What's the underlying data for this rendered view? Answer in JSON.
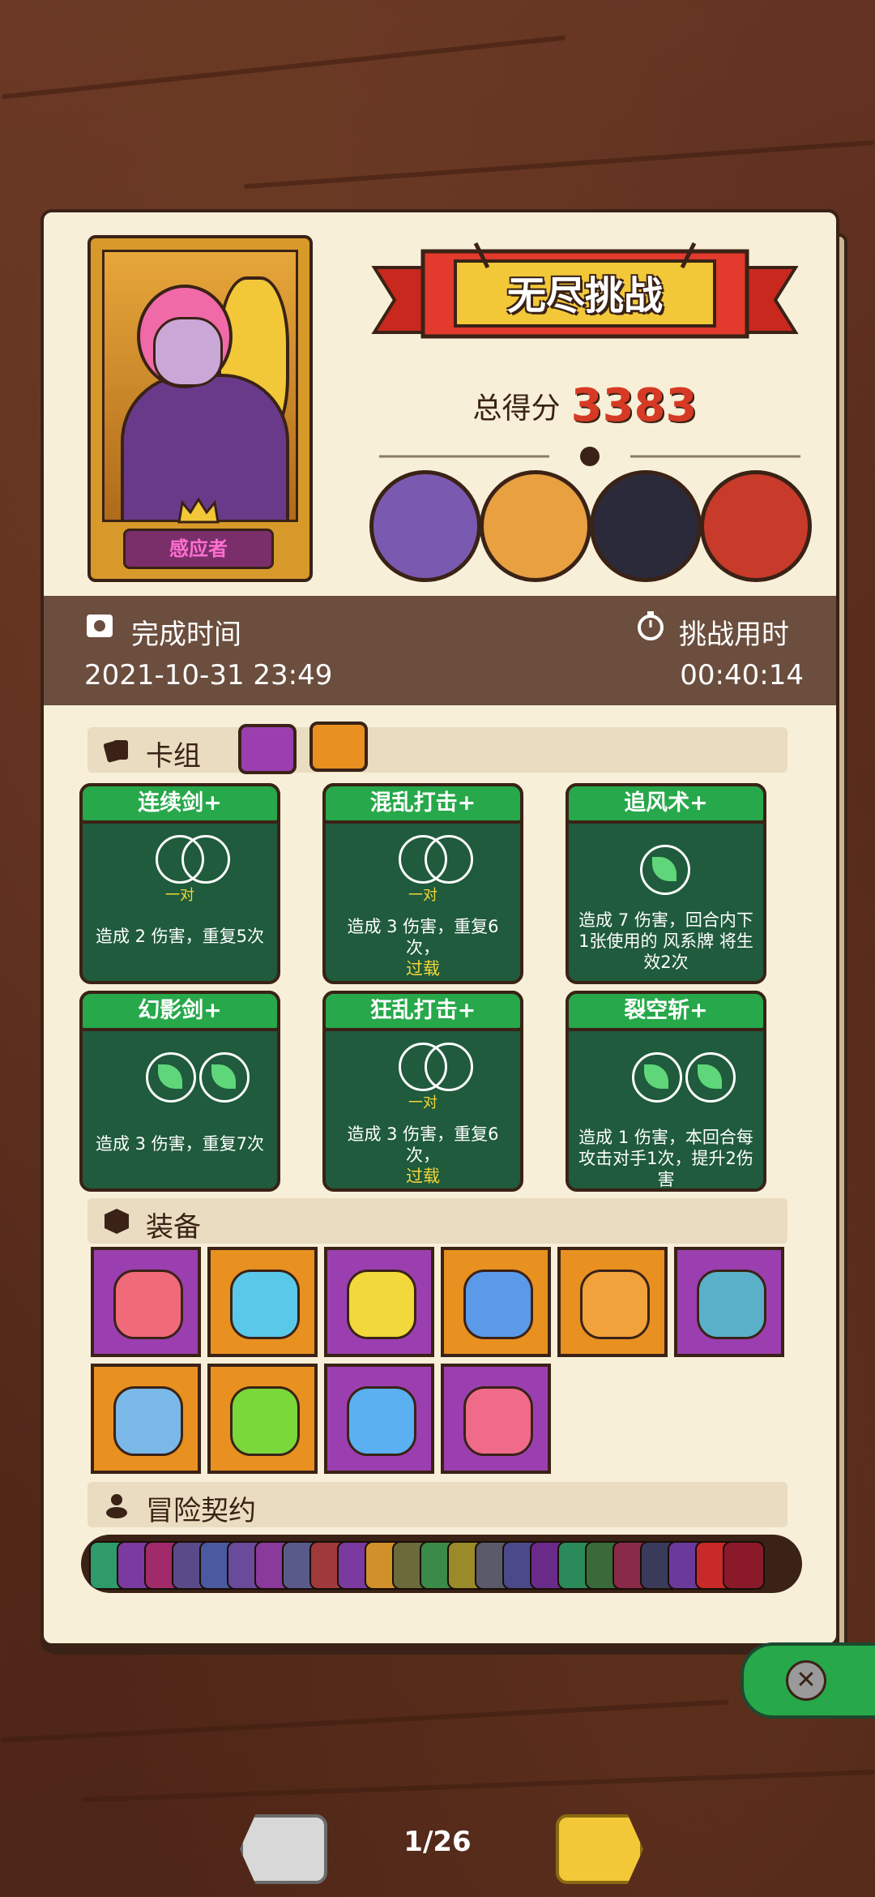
{
  "hero": {
    "name": "感应者"
  },
  "banner": {
    "title": "无尽挑战"
  },
  "score": {
    "label": "总得分",
    "value": "3383"
  },
  "time": {
    "complete_label": "完成时间",
    "complete_value": "2021-10-31 23:49",
    "duration_label": "挑战用时",
    "duration_value": "00:40:14"
  },
  "deck": {
    "title": "卡组",
    "cards": [
      {
        "name": "连续剑+",
        "desc": "造成 2 伤害，重复5次",
        "pair": "一对",
        "warn": ""
      },
      {
        "name": "混乱打击+",
        "desc": "造成 3 伤害，重复6次，",
        "pair": "一对",
        "warn": "过载"
      },
      {
        "name": "追风术+",
        "desc": "造成 7 伤害，回合内下1张使用的 风系牌 将生效2次",
        "pair": "",
        "warn": ""
      },
      {
        "name": "幻影剑+",
        "desc": "造成 3 伤害，重复7次",
        "pair": "",
        "warn": ""
      },
      {
        "name": "狂乱打击+",
        "desc": "造成 3 伤害，重复6次，",
        "pair": "一对",
        "warn": "过载"
      },
      {
        "name": "裂空斩+",
        "desc": "造成 1 伤害，本回合每攻击对手1次，提升2伤害",
        "pair": "",
        "warn": ""
      }
    ]
  },
  "equipment": {
    "title": "装备"
  },
  "contract": {
    "title": "冒险契约"
  },
  "pager": {
    "text": "1/26"
  },
  "colors": {
    "purple": "#9b3fb0",
    "orange": "#e89020",
    "green": "#27a84a",
    "dark_green": "#1f5b3c",
    "red": "#d63a24"
  },
  "icons": {
    "complete": "film-icon",
    "duration": "stopwatch-icon",
    "deck": "cards-icon",
    "equip": "box-icon",
    "contract": "pouch-icon",
    "close": "close-icon"
  }
}
